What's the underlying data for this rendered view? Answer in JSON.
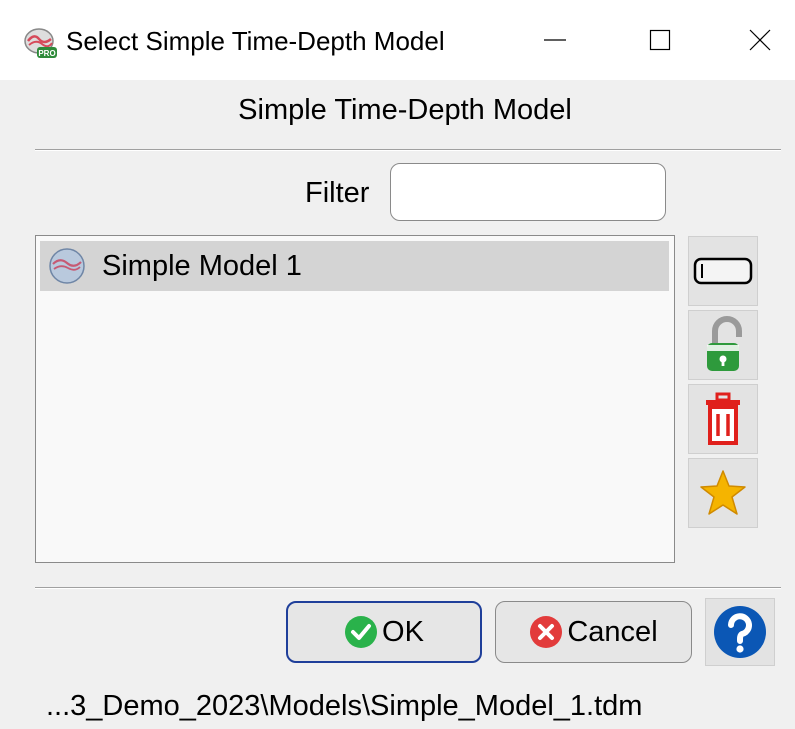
{
  "window": {
    "title": "Select Simple Time-Depth Model",
    "app_icon": "time-depth-pro-icon",
    "controls": [
      "minimize-icon",
      "maximize-icon",
      "close-icon"
    ]
  },
  "heading": "Simple Time-Depth Model",
  "filter": {
    "label": "Filter",
    "value": "",
    "placeholder": ""
  },
  "model_list": {
    "items": [
      {
        "label": "Simple Model 1",
        "icon": "simple-model-icon",
        "selected": true
      }
    ]
  },
  "side_toolbar": [
    {
      "icon": "rename-icon"
    },
    {
      "icon": "unlock-icon"
    },
    {
      "icon": "trash-icon"
    },
    {
      "icon": "star-icon"
    }
  ],
  "buttons": {
    "ok_label": "OK",
    "cancel_label": "Cancel",
    "help_icon": "help-icon"
  },
  "status": {
    "path": "...3_Demo_2023\\Models\\Simple_Model_1.tdm"
  },
  "colors": {
    "ok_border": "#1f3f9a",
    "ok_icon": "#2ab24b",
    "cancel_icon": "#e23b3b",
    "help_icon": "#0b57b5",
    "trash": "#e0201c",
    "unlock": "#2e9a3c",
    "star": "#f5b400"
  }
}
